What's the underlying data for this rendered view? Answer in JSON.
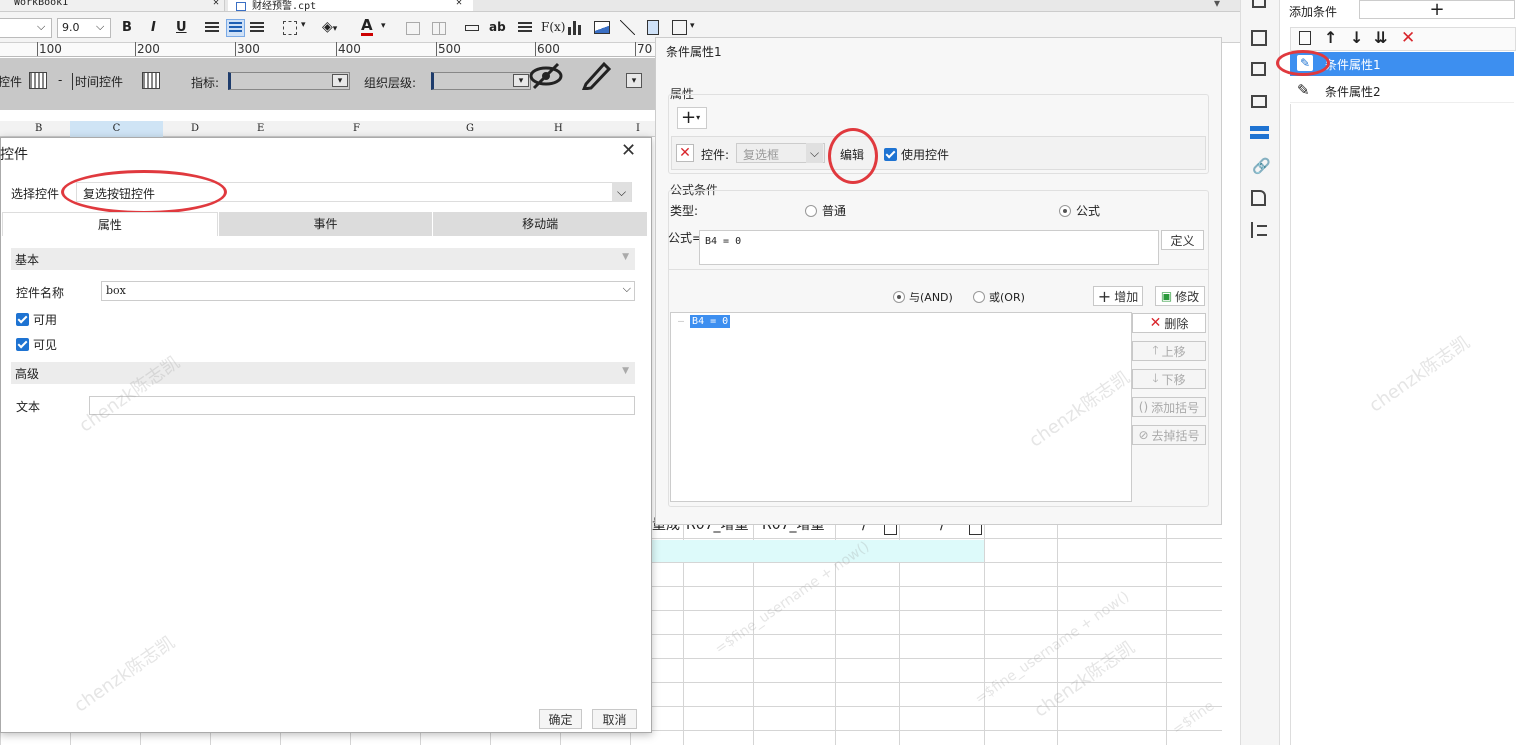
{
  "tabs": [
    {
      "label": "WorkBook1"
    },
    {
      "label": "财经预警.cpt"
    }
  ],
  "toolbar": {
    "font_size": "9.0",
    "bold": "B",
    "italic": "I",
    "underline": "U",
    "text_ab": "ab",
    "fx": "F(x)"
  },
  "ruler": [
    "100",
    "200",
    "300",
    "400",
    "500",
    "600",
    "70"
  ],
  "param_bar": {
    "ctrl_a": "控件",
    "ctrl_dash": "-",
    "time_ctrl": "时间控件",
    "indicator_label": "指标:",
    "org_label": "组织层级:"
  },
  "col_headers": [
    "B",
    "C",
    "D",
    "E",
    "F",
    "G",
    "H",
    "I"
  ],
  "sheet_cells": {
    "c1": "量成",
    "c2": "R07_增量",
    "c3": "R07_增量",
    "c4": "/",
    "c5": "/"
  },
  "widget_dialog": {
    "title": "控件",
    "select_label": "选择控件",
    "select_value": "复选按钮控件",
    "tabs": [
      "属性",
      "事件",
      "移动端"
    ],
    "basic_header": "基本",
    "name_label": "控件名称",
    "name_value": "box",
    "enabled_label": "可用",
    "visible_label": "可见",
    "advanced_header": "高级",
    "text_label": "文本",
    "ok": "确定",
    "cancel": "取消"
  },
  "cond_panel": {
    "title": "条件属性1",
    "attr_section": "属性",
    "ctrl_label": "控件:",
    "ctrl_value": "复选框",
    "edit": "编辑",
    "use_ctrl": "使用控件",
    "formula_section": "公式条件",
    "type_label": "类型:",
    "type_normal": "普通",
    "type_formula": "公式",
    "formula_label": "公式=",
    "formula_value": "B4 = 0",
    "define": "定义",
    "and_label": "与(AND)",
    "or_label": "或(OR)",
    "add": "增加",
    "modify": "修改",
    "list_item": "B4 = 0",
    "delete": "删除",
    "move_up": "上移",
    "move_down": "下移",
    "add_bracket": "添加括号",
    "remove_bracket": "去掉括号"
  },
  "right_panel": {
    "add_condition": "添加条件",
    "items": [
      {
        "label": "条件属性1"
      },
      {
        "label": "条件属性2"
      }
    ]
  },
  "watermarks": [
    "chenzk陈志凯",
    "chenzk陈志凯",
    "chenzk陈志凯",
    "chenzk陈志凯",
    "chenzk陈志凯",
    "=$fine_username + now()",
    "=$fine_username + now()",
    "=$fine"
  ],
  "colors": {
    "accent": "#1e73d2",
    "selected_row": "#3d8ff0",
    "highlight_circle": "#e0393e",
    "delete_red": "#d9262c",
    "sheet_highlight": "#ddfafa"
  }
}
